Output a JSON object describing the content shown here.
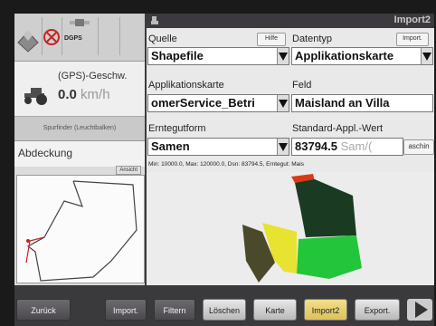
{
  "status": {
    "dgps_label": "DGPS"
  },
  "speed": {
    "label": "(GPS)-Geschw.",
    "value": "0.0",
    "unit": "km/h"
  },
  "left": {
    "spurfinder": "Spurfinder (Leuchtbalken)",
    "abdeckung": "Abdeckung",
    "ansicht": "Ansicht"
  },
  "header": {
    "title": "Import2"
  },
  "form": {
    "quelle_label": "Quelle",
    "hilfe": "Hilfe",
    "quelle_value": "Shapefile",
    "datentyp_label": "Datentyp",
    "import_small": "Import.",
    "datentyp_value": "Applikationskarte",
    "applikationskarte_label": "Applikationskarte",
    "applikationskarte_value": "omerService_Betri",
    "feld_label": "Feld",
    "feld_value": "Maisland an Villa",
    "erntegutform_label": "Erntegutform",
    "erntegutform_value": "Samen",
    "standard_label": "Standard-Appl.-Wert",
    "standard_value": "83794.5",
    "standard_unit": "Sam/(",
    "standard_btn": "aschin"
  },
  "info": {
    "line": "Min: 10000.0, Max: 120000.0, Dsn: 83794.5, Erntegut: Mais"
  },
  "bottom": {
    "zurueck": "Zurück",
    "import": "Import.",
    "filtern": "Filtern",
    "loeschen": "Löschen",
    "karte": "Karte",
    "import2": "Import2",
    "export": "Export."
  },
  "colors": {
    "map_dark_green": "#1a3a22",
    "map_green": "#23c63a",
    "map_yellow": "#e8e230",
    "map_olive": "#4a4a2b",
    "map_red": "#d83a18",
    "active_tab": "#e6cf6c"
  }
}
